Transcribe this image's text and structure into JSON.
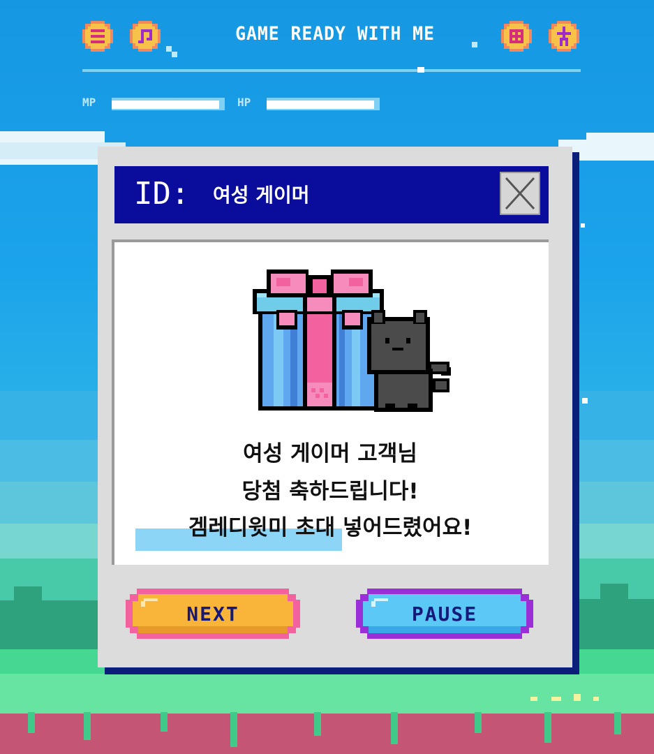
{
  "header": {
    "title": "GAME READY WITH ME",
    "icons": [
      "menu-icon",
      "music-icon",
      "grid-icon",
      "plus-icon"
    ],
    "mp_label": "MP",
    "hp_label": "HP",
    "mp_level": 0.95,
    "hp_level": 0.95
  },
  "dialog": {
    "id_prefix": "ID:",
    "id_name": "여성 게이머",
    "message_lines": [
      "여성 게이머 고객님",
      "당첨 축하드립니다!",
      "겜레디윗미 초대 넣어드렸어요!"
    ],
    "next_label": "NEXT",
    "pause_label": "PAUSE"
  },
  "colors": {
    "titlebar": "#0a0c9c",
    "next_button": "#f9b43a",
    "pause_button": "#5cc8f5",
    "highlight": "#8dd5f7"
  }
}
